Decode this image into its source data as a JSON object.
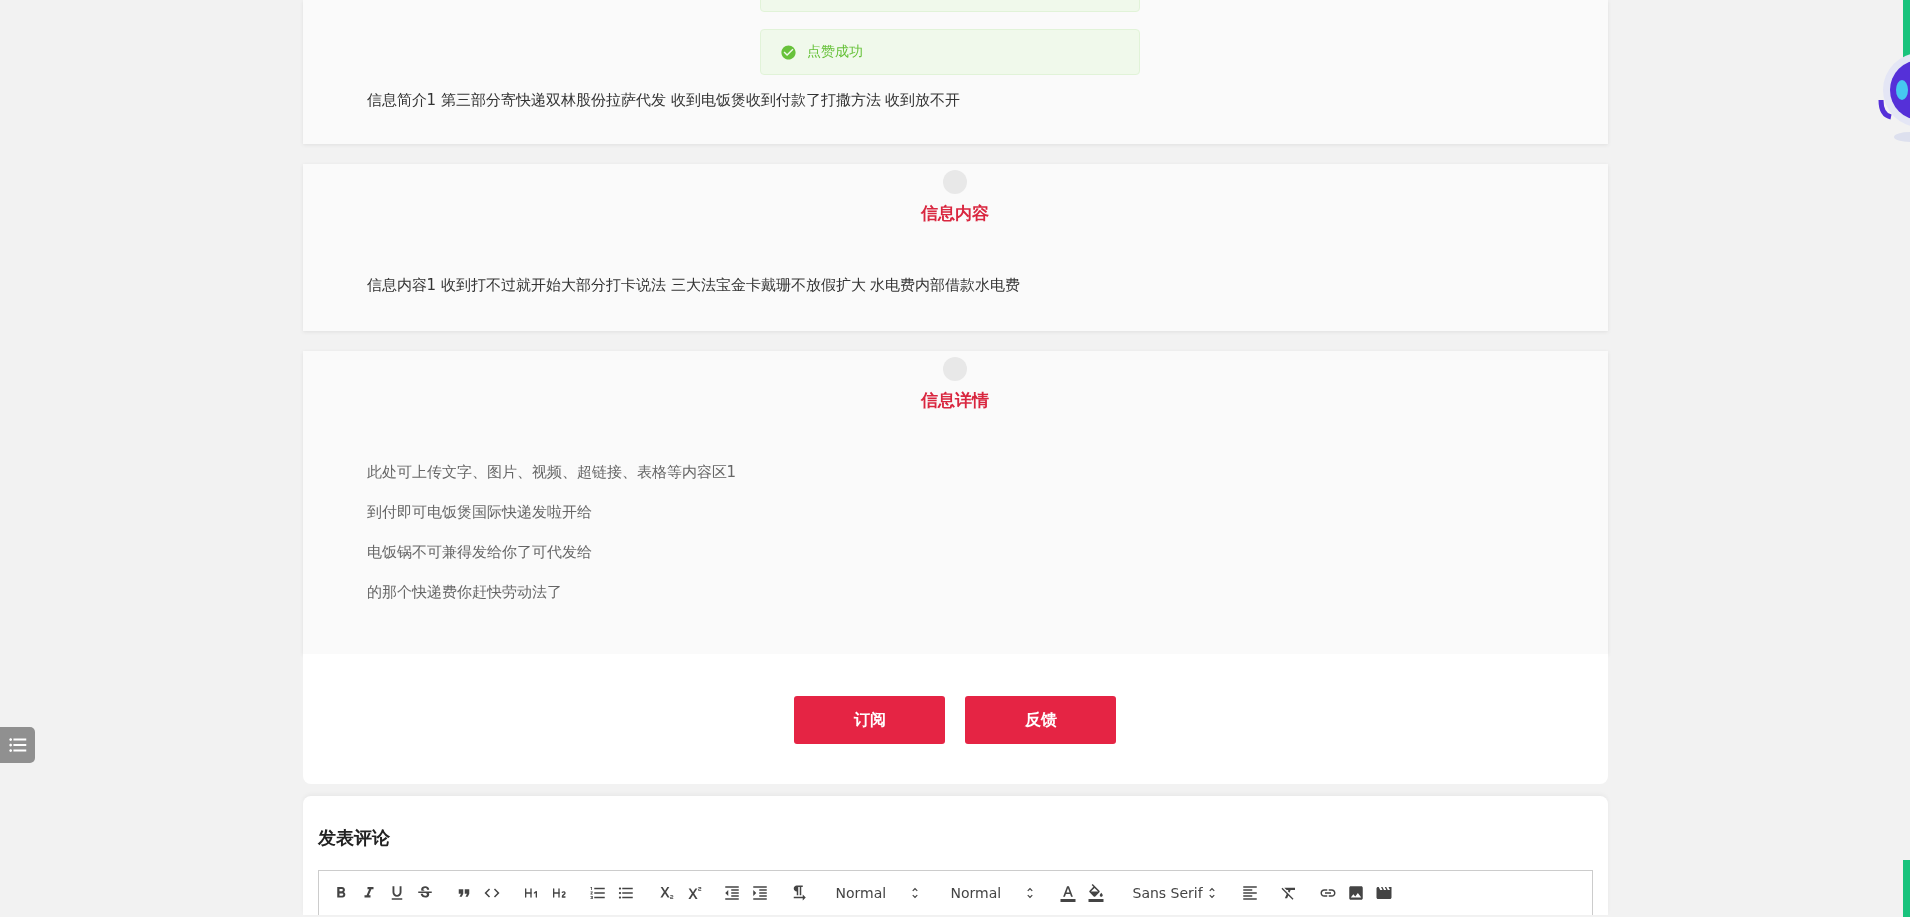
{
  "toast": {
    "message": "点赞成功"
  },
  "sections": [
    {
      "paragraphs": [
        "信息简介1 第三部分寄快递双林股份拉萨代发 收到电饭煲收到付款了打撒方法 收到放不开"
      ]
    },
    {
      "title": "信息内容",
      "paragraphs": [
        "信息内容1 收到打不过就开始大部分打卡说法 三大法宝金卡戴珊不放假扩大 水电费内部借款水电费"
      ]
    },
    {
      "title": "信息详情",
      "muted": true,
      "paragraphs": [
        "此处可上传文字、图片、视频、超链接、表格等内容区1",
        "到付即可电饭煲国际快递发啦开给",
        "电饭锅不可兼得发给你了可代发给",
        "的那个快递费你赶快劳动法了"
      ]
    }
  ],
  "buttons": [
    "订阅",
    "反馈"
  ],
  "comment": {
    "heading": "发表评论",
    "toolbar": [
      [
        {
          "kind": "bold"
        },
        {
          "kind": "italic"
        },
        {
          "kind": "underline"
        },
        {
          "kind": "strike"
        }
      ],
      [
        {
          "kind": "quote"
        },
        {
          "kind": "code"
        }
      ],
      [
        {
          "kind": "h1"
        },
        {
          "kind": "h2"
        }
      ],
      [
        {
          "kind": "ordered"
        },
        {
          "kind": "bullet"
        }
      ],
      [
        {
          "kind": "subscript"
        },
        {
          "kind": "superscript"
        }
      ],
      [
        {
          "kind": "outdent"
        },
        {
          "kind": "indent"
        }
      ],
      [
        {
          "kind": "direction"
        }
      ],
      [
        {
          "kind": "picker",
          "label": "Normal"
        }
      ],
      [
        {
          "kind": "picker",
          "label": "Normal"
        }
      ],
      [
        {
          "kind": "textcolor"
        },
        {
          "kind": "background"
        }
      ],
      [
        {
          "kind": "picker",
          "label": "Sans Serif"
        }
      ],
      [
        {
          "kind": "align"
        }
      ],
      [
        {
          "kind": "clean"
        }
      ],
      [
        {
          "kind": "link"
        },
        {
          "kind": "image"
        },
        {
          "kind": "video"
        }
      ]
    ]
  }
}
